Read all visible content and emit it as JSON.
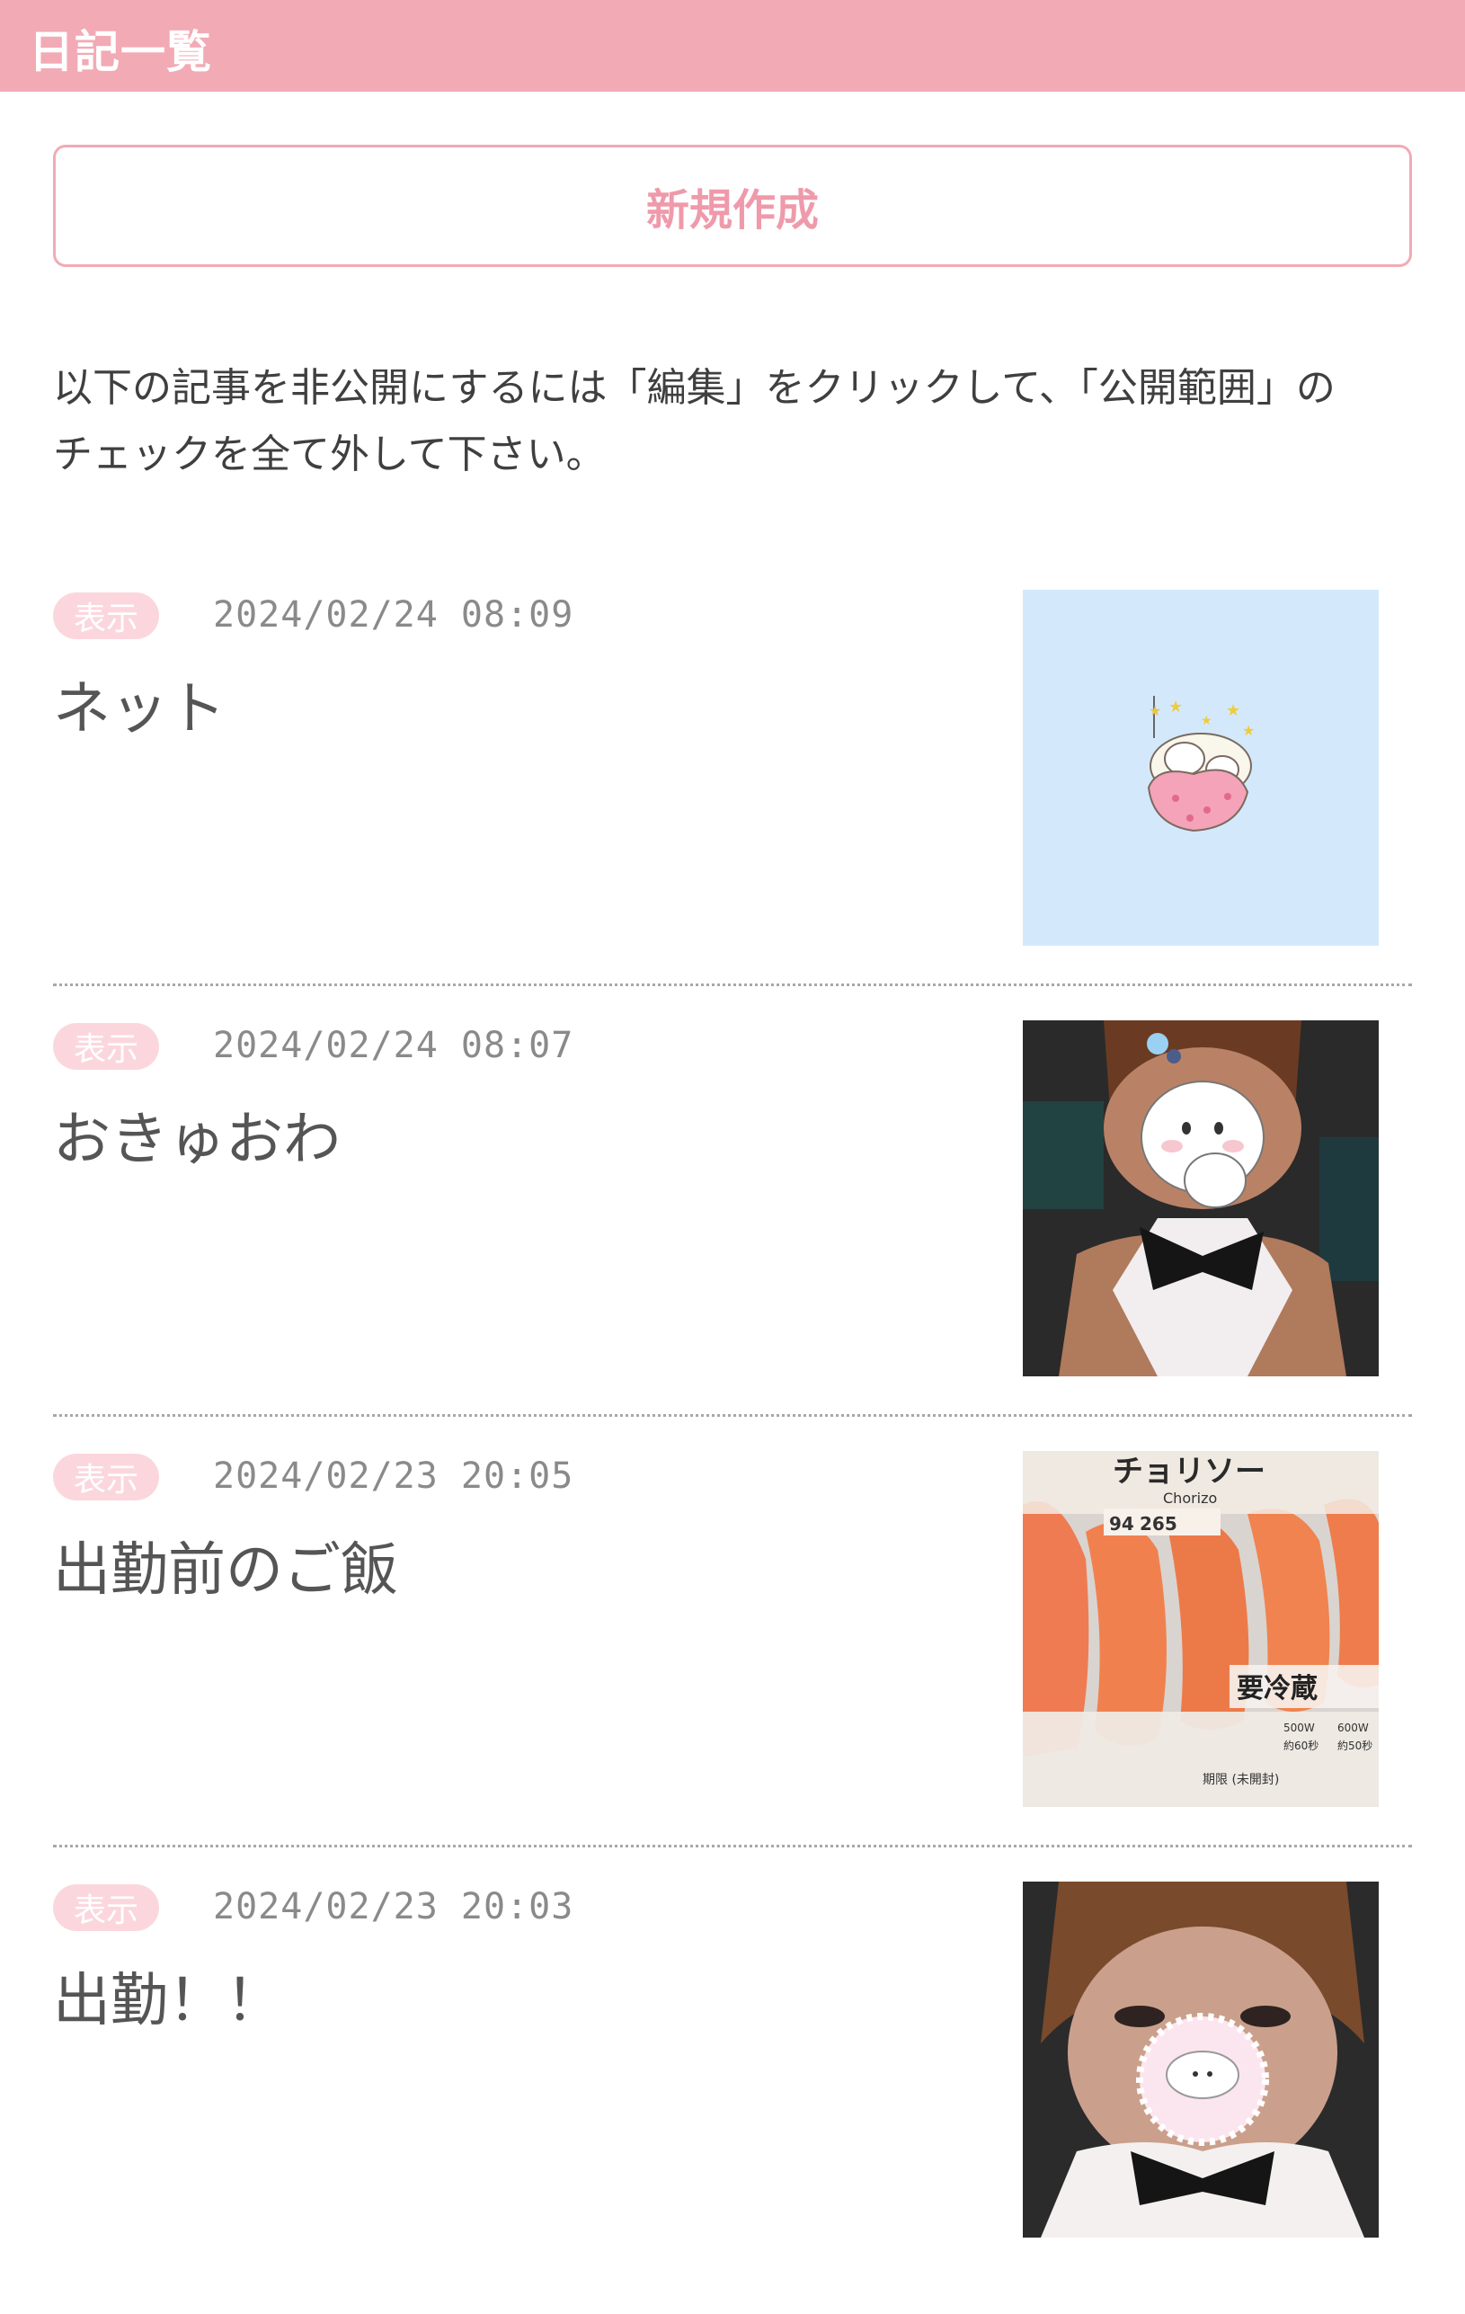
{
  "header": {
    "title": "日記一覧"
  },
  "actions": {
    "new_label": "新規作成"
  },
  "notice": "以下の記事を非公開にするには「編集」をクリックして、「公開範囲」のチェックを全て外して下さい。",
  "entries": [
    {
      "status": "表示",
      "datetime": "2024/02/24 08:09",
      "title": "ネット",
      "thumbnail": "sleeping-hamster-sticker"
    },
    {
      "status": "表示",
      "datetime": "2024/02/24 08:07",
      "title": "おきゅおわ",
      "thumbnail": "selfie-photo"
    },
    {
      "status": "表示",
      "datetime": "2024/02/23 20:05",
      "title": "出勤前のご飯",
      "thumbnail": "chorizo-photo"
    },
    {
      "status": "表示",
      "datetime": "2024/02/23 20:03",
      "title": "出勤！！",
      "thumbnail": "selfie-photo"
    }
  ],
  "thumb_texts": {
    "chorizo_brand": "チョリソー",
    "chorizo_en": "Chorizo",
    "chorizo_n1": "94",
    "chorizo_n2": "265",
    "chorizo_fridge": "要冷蔵",
    "chorizo_w1": "500W",
    "chorizo_w2": "600W",
    "chorizo_t1": "約60秒",
    "chorizo_t2": "約50秒",
    "chorizo_expiry": "期限 (未開封)"
  },
  "colors": {
    "accent": "#f2aab5",
    "badge": "#fbd7dd"
  }
}
